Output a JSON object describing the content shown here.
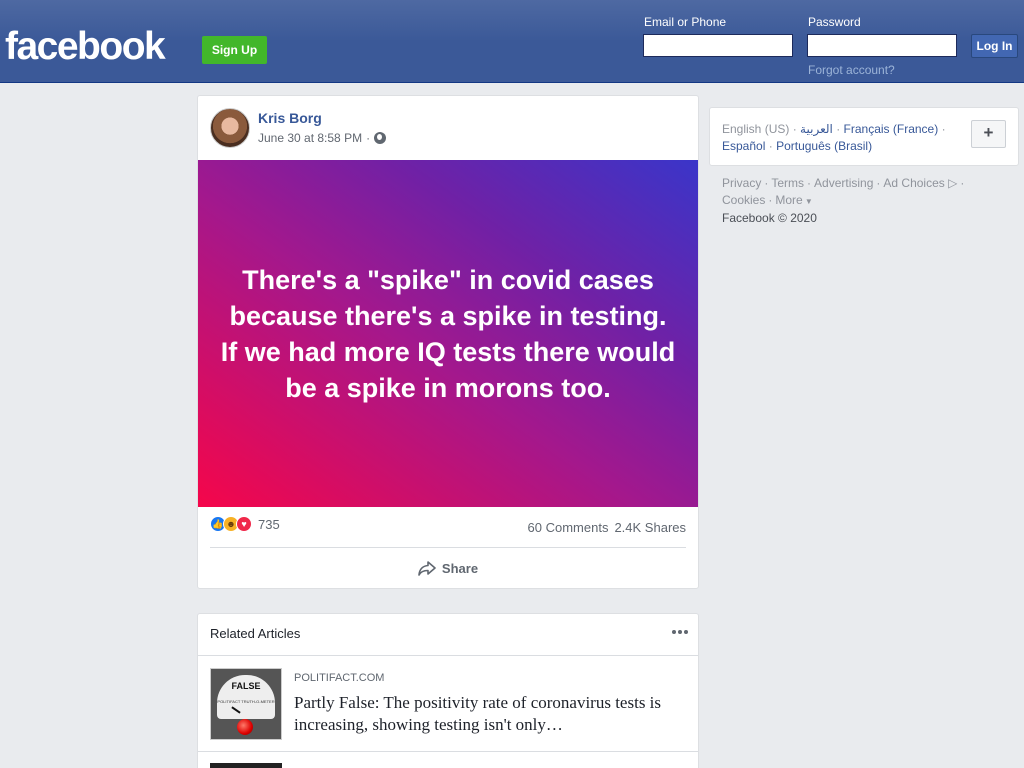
{
  "header": {
    "logo": "facebook",
    "signup_label": "Sign Up",
    "email_label": "Email or Phone",
    "email_value": "",
    "password_label": "Password",
    "password_value": "",
    "login_label": "Log In",
    "forgot_label": "Forgot account?"
  },
  "post": {
    "author": "Kris Borg",
    "timestamp": "June 30 at 8:58 PM",
    "meta_separator": "·",
    "privacy_icon": "globe-icon",
    "text": "There's a \"spike\" in covid cases because there's a spike in testing.\nIf we had more IQ tests there would be a spike in morons too.",
    "banner_colors": [
      "#f5064a",
      "#a3188d",
      "#3a35c9"
    ],
    "reaction_icons": [
      "like-icon",
      "haha-icon",
      "love-icon"
    ],
    "reaction_count": "735",
    "comments": "60 Comments",
    "shares": "2.4K Shares",
    "share_label": "Share"
  },
  "related": {
    "title": "Related Articles",
    "items": [
      {
        "source": "POLITIFACT.COM",
        "headline": "Partly False: The positivity rate of coronavirus tests is increasing, showing testing isn't only…",
        "thumb_label": "FALSE",
        "thumb_sub": "POLITIFACT TRUTH-O-METER"
      }
    ]
  },
  "languages": {
    "current": "English (US)",
    "options": [
      "العربية",
      "Français (France)",
      "Español",
      "Português (Brasil)"
    ],
    "add_label": "+"
  },
  "footer": {
    "links": [
      "Privacy",
      "Terms",
      "Advertising",
      "Ad Choices",
      "Cookies",
      "More"
    ],
    "copyright": "Facebook © 2020"
  },
  "colors": {
    "brand": "#3b5998",
    "signup": "#42b72a",
    "link": "#385898",
    "background": "#e9ebee"
  }
}
